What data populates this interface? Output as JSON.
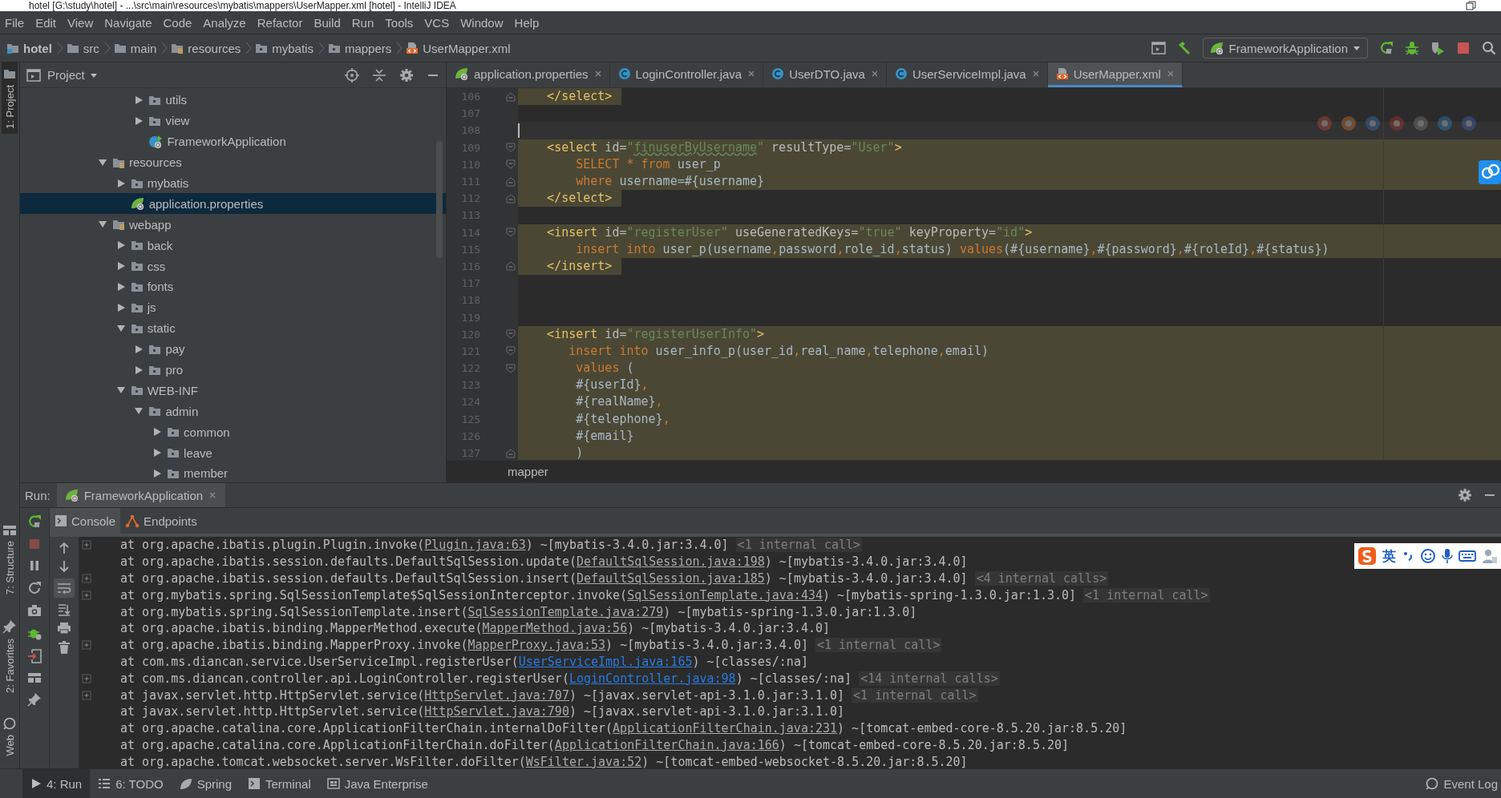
{
  "window": {
    "title": "hotel [G:\\study\\hotel] - ...\\src\\main\\resources\\mybatis\\mappers\\UserMapper.xml [hotel] - IntelliJ IDEA"
  },
  "menu": [
    "File",
    "Edit",
    "View",
    "Navigate",
    "Code",
    "Analyze",
    "Refactor",
    "Build",
    "Run",
    "Tools",
    "VCS",
    "Window",
    "Help"
  ],
  "breadcrumbs": [
    {
      "label": "hotel",
      "kind": "module"
    },
    {
      "label": "src",
      "kind": "folder"
    },
    {
      "label": "main",
      "kind": "folder"
    },
    {
      "label": "resources",
      "kind": "resource-folder"
    },
    {
      "label": "mybatis",
      "kind": "package"
    },
    {
      "label": "mappers",
      "kind": "package"
    },
    {
      "label": "UserMapper.xml",
      "kind": "xml"
    }
  ],
  "run_config": {
    "label": "FrameworkApplication"
  },
  "tool_stripe": {
    "top": [
      {
        "label": "1: Project",
        "selected": true
      }
    ],
    "bottom": [
      {
        "label": "7: Structure",
        "selected": false
      },
      {
        "label": "2: Favorites",
        "selected": false
      },
      {
        "label": "Web",
        "selected": false
      }
    ]
  },
  "project_panel": {
    "title": "Project",
    "tree": [
      {
        "kind": "continued",
        "children": [
          {
            "kind": "continued",
            "children": [
              {
                "label": "utils",
                "kind": "package",
                "expanded": false,
                "selected": false
              },
              {
                "label": "view",
                "kind": "package",
                "expanded": false,
                "selected": false
              },
              {
                "label": "FrameworkApplication",
                "kind": "spring-class",
                "selected": false
              }
            ]
          }
        ]
      },
      {
        "label": "resources",
        "kind": "resource-folder",
        "expanded": true,
        "selected": false,
        "children": [
          {
            "label": "mybatis",
            "kind": "package",
            "expanded": false,
            "selected": false
          },
          {
            "label": "application.properties",
            "kind": "spring-config",
            "selected": true
          }
        ]
      },
      {
        "label": "webapp",
        "kind": "resource-folder",
        "expanded": true,
        "selected": false,
        "children": [
          {
            "label": "back",
            "kind": "package",
            "expanded": false,
            "selected": false
          },
          {
            "label": "css",
            "kind": "package",
            "expanded": false,
            "selected": false
          },
          {
            "label": "fonts",
            "kind": "package",
            "expanded": false,
            "selected": false
          },
          {
            "label": "js",
            "kind": "package",
            "expanded": false,
            "selected": false
          },
          {
            "label": "static",
            "kind": "package",
            "expanded": true,
            "selected": false,
            "children": [
              {
                "label": "pay",
                "kind": "package",
                "expanded": false,
                "selected": false
              },
              {
                "label": "pro",
                "kind": "package",
                "expanded": false,
                "selected": false
              }
            ]
          },
          {
            "label": "WEB-INF",
            "kind": "package",
            "expanded": true,
            "selected": false,
            "children": [
              {
                "label": "admin",
                "kind": "package",
                "expanded": true,
                "selected": false,
                "children": [
                  {
                    "label": "common",
                    "kind": "package",
                    "expanded": false,
                    "selected": false
                  },
                  {
                    "label": "leave",
                    "kind": "package",
                    "expanded": false,
                    "selected": false
                  },
                  {
                    "label": "member",
                    "kind": "package",
                    "expanded": false,
                    "selected": false
                  }
                ]
              }
            ]
          }
        ]
      }
    ]
  },
  "editor": {
    "tabs": [
      {
        "label": "application.properties",
        "kind": "spring-config",
        "selected": false
      },
      {
        "label": "LoginController.java",
        "kind": "class",
        "selected": false
      },
      {
        "label": "UserDTO.java",
        "kind": "class",
        "selected": false
      },
      {
        "label": "UserServiceImpl.java",
        "kind": "class",
        "selected": false
      },
      {
        "label": "UserMapper.xml",
        "kind": "xml",
        "selected": true
      }
    ],
    "lines": [
      {
        "number": "106",
        "kind": "fold-end",
        "highlighted": true,
        "short": true,
        "caret": false,
        "segments": [
          {
            "kind": "tag",
            "s": "    </select>"
          }
        ]
      },
      {
        "number": "107",
        "kind": "plain",
        "caret": false
      },
      {
        "number": "108",
        "kind": "plain",
        "caret": true
      },
      {
        "number": "109",
        "kind": "fold-start",
        "highlighted": true,
        "short": false,
        "caret": false,
        "segments": [
          {
            "kind": "tag",
            "s": "    <select"
          },
          {
            "kind": "attr",
            "s": " id="
          },
          {
            "kind": "value",
            "s": "\""
          },
          {
            "kind": "typo",
            "s": "finuserByUsername"
          },
          {
            "kind": "value",
            "s": "\""
          },
          {
            "kind": "attr",
            "s": " resultType="
          },
          {
            "kind": "value",
            "s": "\"User\""
          },
          {
            "kind": "tag",
            "s": ">"
          }
        ]
      },
      {
        "number": "110",
        "kind": "fold-start",
        "highlighted": true,
        "short": false,
        "caret": false,
        "segments": [
          {
            "kind": "kw",
            "s": "        SELECT * from"
          },
          {
            "kind": "plain",
            "s": " user_p"
          }
        ]
      },
      {
        "number": "111",
        "kind": "fold-end",
        "highlighted": true,
        "short": false,
        "caret": false,
        "segments": [
          {
            "kind": "kw",
            "s": "        where"
          },
          {
            "kind": "plain",
            "s": " username=#{username}"
          }
        ]
      },
      {
        "number": "112",
        "kind": "fold-end",
        "highlighted": true,
        "short": true,
        "caret": false,
        "segments": [
          {
            "kind": "tag",
            "s": "    </select>"
          }
        ]
      },
      {
        "number": "113",
        "kind": "plain",
        "caret": false
      },
      {
        "number": "114",
        "kind": "fold-start",
        "highlighted": true,
        "short": false,
        "caret": false,
        "segments": [
          {
            "kind": "tag",
            "s": "    <insert"
          },
          {
            "kind": "attr",
            "s": " id="
          },
          {
            "kind": "value",
            "s": "\"registerUser\""
          },
          {
            "kind": "attr",
            "s": " useGeneratedKeys="
          },
          {
            "kind": "value",
            "s": "\"true\""
          },
          {
            "kind": "attr",
            "s": " keyProperty="
          },
          {
            "kind": "value",
            "s": "\"id\""
          },
          {
            "kind": "tag",
            "s": ">"
          }
        ]
      },
      {
        "number": "115",
        "kind": "plain",
        "highlighted": true,
        "short": false,
        "caret": false,
        "segments": [
          {
            "kind": "kw",
            "s": "        insert into"
          },
          {
            "kind": "plain",
            "s": " user_p(username"
          },
          {
            "kind": "kw",
            "s": ","
          },
          {
            "kind": "plain",
            "s": "password"
          },
          {
            "kind": "kw",
            "s": ","
          },
          {
            "kind": "plain",
            "s": "role_id"
          },
          {
            "kind": "kw",
            "s": ","
          },
          {
            "kind": "plain",
            "s": "status) "
          },
          {
            "kind": "kw",
            "s": "values"
          },
          {
            "kind": "plain",
            "s": "(#{username}"
          },
          {
            "kind": "kw",
            "s": ","
          },
          {
            "kind": "plain",
            "s": "#{password}"
          },
          {
            "kind": "kw",
            "s": ","
          },
          {
            "kind": "plain",
            "s": "#{roleId}"
          },
          {
            "kind": "kw",
            "s": ","
          },
          {
            "kind": "plain",
            "s": "#{status})"
          }
        ]
      },
      {
        "number": "116",
        "kind": "fold-end",
        "highlighted": true,
        "short": true,
        "caret": false,
        "segments": [
          {
            "kind": "tag",
            "s": "    </insert>"
          }
        ]
      },
      {
        "number": "117",
        "kind": "plain",
        "caret": false
      },
      {
        "number": "118",
        "kind": "plain",
        "caret": false
      },
      {
        "number": "119",
        "kind": "plain",
        "caret": false
      },
      {
        "number": "120",
        "kind": "fold-start",
        "highlighted": true,
        "short": false,
        "caret": false,
        "segments": [
          {
            "kind": "tag",
            "s": "    <insert"
          },
          {
            "kind": "attr",
            "s": " id="
          },
          {
            "kind": "value",
            "s": "\"registerUserInfo\""
          },
          {
            "kind": "tag",
            "s": ">"
          }
        ]
      },
      {
        "number": "121",
        "kind": "fold-start",
        "highlighted": true,
        "short": false,
        "caret": false,
        "segments": [
          {
            "kind": "kw",
            "s": "       insert into"
          },
          {
            "kind": "plain",
            "s": " user_info_p(user_id"
          },
          {
            "kind": "kw",
            "s": ","
          },
          {
            "kind": "plain",
            "s": "real_name"
          },
          {
            "kind": "kw",
            "s": ","
          },
          {
            "kind": "plain",
            "s": "telephone"
          },
          {
            "kind": "kw",
            "s": ","
          },
          {
            "kind": "plain",
            "s": "email)"
          }
        ]
      },
      {
        "number": "122",
        "kind": "fold-start",
        "highlighted": true,
        "short": false,
        "caret": false,
        "segments": [
          {
            "kind": "kw",
            "s": "        values"
          },
          {
            "kind": "plain",
            "s": " ("
          }
        ]
      },
      {
        "number": "123",
        "kind": "plain",
        "highlighted": true,
        "short": false,
        "caret": false,
        "segments": [
          {
            "kind": "plain",
            "s": "        #{userId}"
          },
          {
            "kind": "kw",
            "s": ","
          }
        ]
      },
      {
        "number": "124",
        "kind": "plain",
        "highlighted": true,
        "short": false,
        "caret": false,
        "segments": [
          {
            "kind": "plain",
            "s": "        #{realName}"
          },
          {
            "kind": "kw",
            "s": ","
          }
        ]
      },
      {
        "number": "125",
        "kind": "plain",
        "highlighted": true,
        "short": false,
        "caret": false,
        "segments": [
          {
            "kind": "plain",
            "s": "        #{telephone}"
          },
          {
            "kind": "kw",
            "s": ","
          }
        ]
      },
      {
        "number": "126",
        "kind": "plain",
        "highlighted": true,
        "short": false,
        "caret": false,
        "segments": [
          {
            "kind": "plain",
            "s": "        #{email}"
          }
        ]
      },
      {
        "number": "127",
        "kind": "fold-end",
        "highlighted": true,
        "short": false,
        "caret": false,
        "segments": [
          {
            "kind": "plain",
            "s": "        )"
          }
        ]
      }
    ],
    "breadcrumb": "mapper"
  },
  "run_panel": {
    "label": "Run:",
    "tabs": [
      {
        "label": "FrameworkApplication",
        "selected": true
      }
    ],
    "console_tabs": [
      {
        "label": "Console",
        "kind": "console",
        "selected": true
      },
      {
        "label": "Endpoints",
        "kind": "endpoints",
        "selected": false
      }
    ],
    "soft_wrap": true,
    "lines": [
      {
        "text": "at org.apache.ibatis.plugin.Plugin.invoke(",
        "link": "Plugin.java:63",
        "after": ") ~[mybatis-3.4.0.jar:3.4.0]",
        "note": "<1 internal call>",
        "kind": "library",
        "expandable": true
      },
      {
        "text": "at org.apache.ibatis.session.defaults.DefaultSqlSession.update(",
        "link": "DefaultSqlSession.java:198",
        "after": ") ~[mybatis-3.4.0.jar:3.4.0]",
        "kind": "library",
        "expandable": false
      },
      {
        "text": "at org.apache.ibatis.session.defaults.DefaultSqlSession.insert(",
        "link": "DefaultSqlSession.java:185",
        "after": ") ~[mybatis-3.4.0.jar:3.4.0]",
        "note": "<4 internal calls>",
        "kind": "library",
        "expandable": true
      },
      {
        "text": "at org.mybatis.spring.SqlSessionTemplate$SqlSessionInterceptor.invoke(",
        "link": "SqlSessionTemplate.java:434",
        "after": ") ~[mybatis-spring-1.3.0.jar:1.3.0]",
        "note": "<1 internal call>",
        "kind": "library",
        "expandable": true
      },
      {
        "text": "at org.mybatis.spring.SqlSessionTemplate.insert(",
        "link": "SqlSessionTemplate.java:279",
        "after": ") ~[mybatis-spring-1.3.0.jar:1.3.0]",
        "kind": "library",
        "expandable": false
      },
      {
        "text": "at org.apache.ibatis.binding.MapperMethod.execute(",
        "link": "MapperMethod.java:56",
        "after": ") ~[mybatis-3.4.0.jar:3.4.0]",
        "kind": "library",
        "expandable": false
      },
      {
        "text": "at org.apache.ibatis.binding.MapperProxy.invoke(",
        "link": "MapperProxy.java:53",
        "after": ") ~[mybatis-3.4.0.jar:3.4.0]",
        "note": "<1 internal call>",
        "kind": "library",
        "expandable": true
      },
      {
        "text": "at com.ms.diancan.service.UserServiceImpl.registerUser(",
        "link": "UserServiceImpl.java:165",
        "after": ") ~[classes/:na]",
        "kind": "project",
        "expandable": false
      },
      {
        "text": "at com.ms.diancan.controller.api.LoginController.registerUser(",
        "link": "LoginController.java:98",
        "after": ") ~[classes/:na]",
        "note": "<14 internal calls>",
        "kind": "project",
        "expandable": true
      },
      {
        "text": "at javax.servlet.http.HttpServlet.service(",
        "link": "HttpServlet.java:707",
        "after": ") ~[javax.servlet-api-3.1.0.jar:3.1.0]",
        "note": "<1 internal call>",
        "kind": "library",
        "expandable": true
      },
      {
        "text": "at javax.servlet.http.HttpServlet.service(",
        "link": "HttpServlet.java:790",
        "after": ") ~[javax.servlet-api-3.1.0.jar:3.1.0]",
        "kind": "library",
        "expandable": false
      },
      {
        "text": "at org.apache.catalina.core.ApplicationFilterChain.internalDoFilter(",
        "link": "ApplicationFilterChain.java:231",
        "after": ") ~[tomcat-embed-core-8.5.20.jar:8.5.20]",
        "kind": "library",
        "expandable": false
      },
      {
        "text": "at org.apache.catalina.core.ApplicationFilterChain.doFilter(",
        "link": "ApplicationFilterChain.java:166",
        "after": ") ~[tomcat-embed-core-8.5.20.jar:8.5.20]",
        "kind": "library",
        "expandable": false
      },
      {
        "text": "at org.apache.tomcat.websocket.server.WsFilter.doFilter(",
        "link": "WsFilter.java:52",
        "after": ") ~[tomcat-embed-websocket-8.5.20.jar:8.5.20]",
        "kind": "library",
        "expandable": false
      }
    ]
  },
  "ime_toolbar": {
    "label": "英"
  },
  "bottom_bar": {
    "tabs": [
      {
        "label": "4: Run",
        "kind": "run",
        "selected": true
      },
      {
        "label": "6: TODO",
        "kind": "todo",
        "selected": false
      },
      {
        "label": "Spring",
        "kind": "spring",
        "selected": false
      },
      {
        "label": "Terminal",
        "kind": "terminal",
        "selected": false
      },
      {
        "label": "Java Enterprise",
        "kind": "javaee",
        "selected": false
      }
    ],
    "event_log": "Event Log"
  }
}
